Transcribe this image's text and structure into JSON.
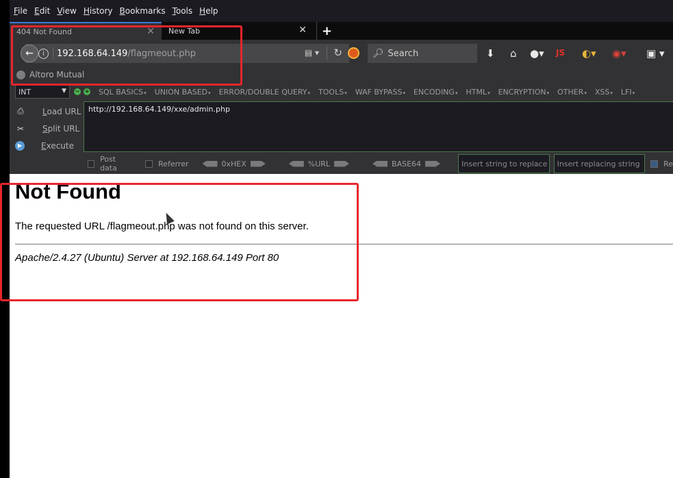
{
  "menubar": [
    "File",
    "Edit",
    "View",
    "History",
    "Bookmarks",
    "Tools",
    "Help"
  ],
  "tabs": [
    {
      "title": "404 Not Found",
      "active": true
    },
    {
      "title": "New Tab",
      "active": false
    }
  ],
  "new_tab_icon": "+",
  "address_bar": {
    "host": "192.168.64.149",
    "path": "/flagmeout.php"
  },
  "search": {
    "placeholder": "Search"
  },
  "toolbar_icons": [
    "download-icon",
    "home-icon",
    "addon-icon",
    "js-icon",
    "extension-icon",
    "stack-icon",
    "share-icon"
  ],
  "toolbar": {
    "js_label": "JS"
  },
  "bookmarks": [
    {
      "label": "Altoro Mutual"
    }
  ],
  "hackbar": {
    "select_value": "INT",
    "menu": [
      "SQL BASICS",
      "UNION BASED",
      "ERROR/DOUBLE QUERY",
      "TOOLS",
      "WAF BYPASS",
      "ENCODING",
      "HTML",
      "ENCRYPTION",
      "OTHER",
      "XSS",
      "LFI"
    ],
    "actions": [
      "Load URL",
      "Split URL",
      "Execute"
    ],
    "url_text": "http://192.168.64.149/xxe/admin.php",
    "options": {
      "post_data": "Post data",
      "referrer": "Referrer",
      "hex": "0xHEX",
      "url": "%URL",
      "base64": "BASE64",
      "replace_placeholder": "Insert string to replace",
      "replacing_placeholder": "Insert replacing string",
      "re_label": "Re"
    }
  },
  "page": {
    "heading": "Not Found",
    "message": "The requested URL /flagmeout.php was not found on this server.",
    "server": "Apache/2.4.27 (Ubuntu) Server at 192.168.64.149 Port 80"
  },
  "colors": {
    "annotation": "#e8262b",
    "accent": "#3a7bd5"
  }
}
